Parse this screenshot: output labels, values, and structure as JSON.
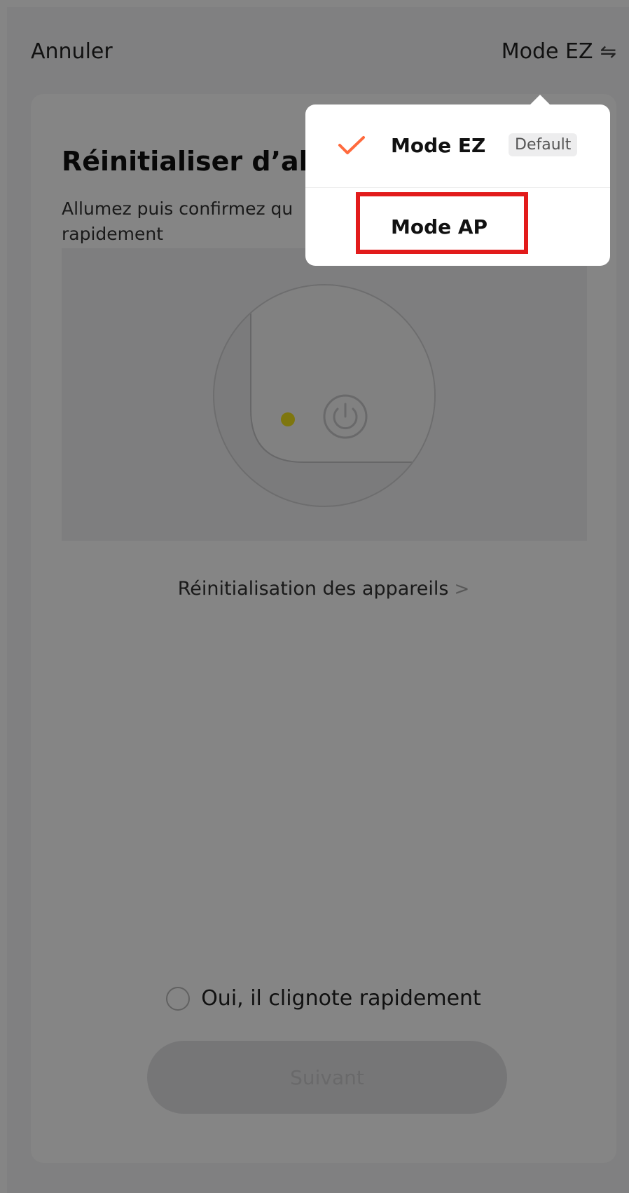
{
  "header": {
    "cancel_label": "Annuler",
    "mode_label": "Mode EZ",
    "mode_icon": "swap-arrows-icon"
  },
  "content": {
    "title": "Réinitialiser d’abo",
    "description": "Allumez puis confirmez qu\nrapidement",
    "reset_link_label": "Réinitialisation des appareils",
    "confirm_label": "Oui, il clignote rapidement",
    "next_label": "Suivant"
  },
  "popover": {
    "items": [
      {
        "label": "Mode EZ",
        "badge": "Default",
        "selected": true
      },
      {
        "label": "Mode AP",
        "selected": false
      }
    ]
  },
  "colors": {
    "accent": "#ff6a3d",
    "highlight": "#e21b1b",
    "led": "#f2e21c"
  }
}
